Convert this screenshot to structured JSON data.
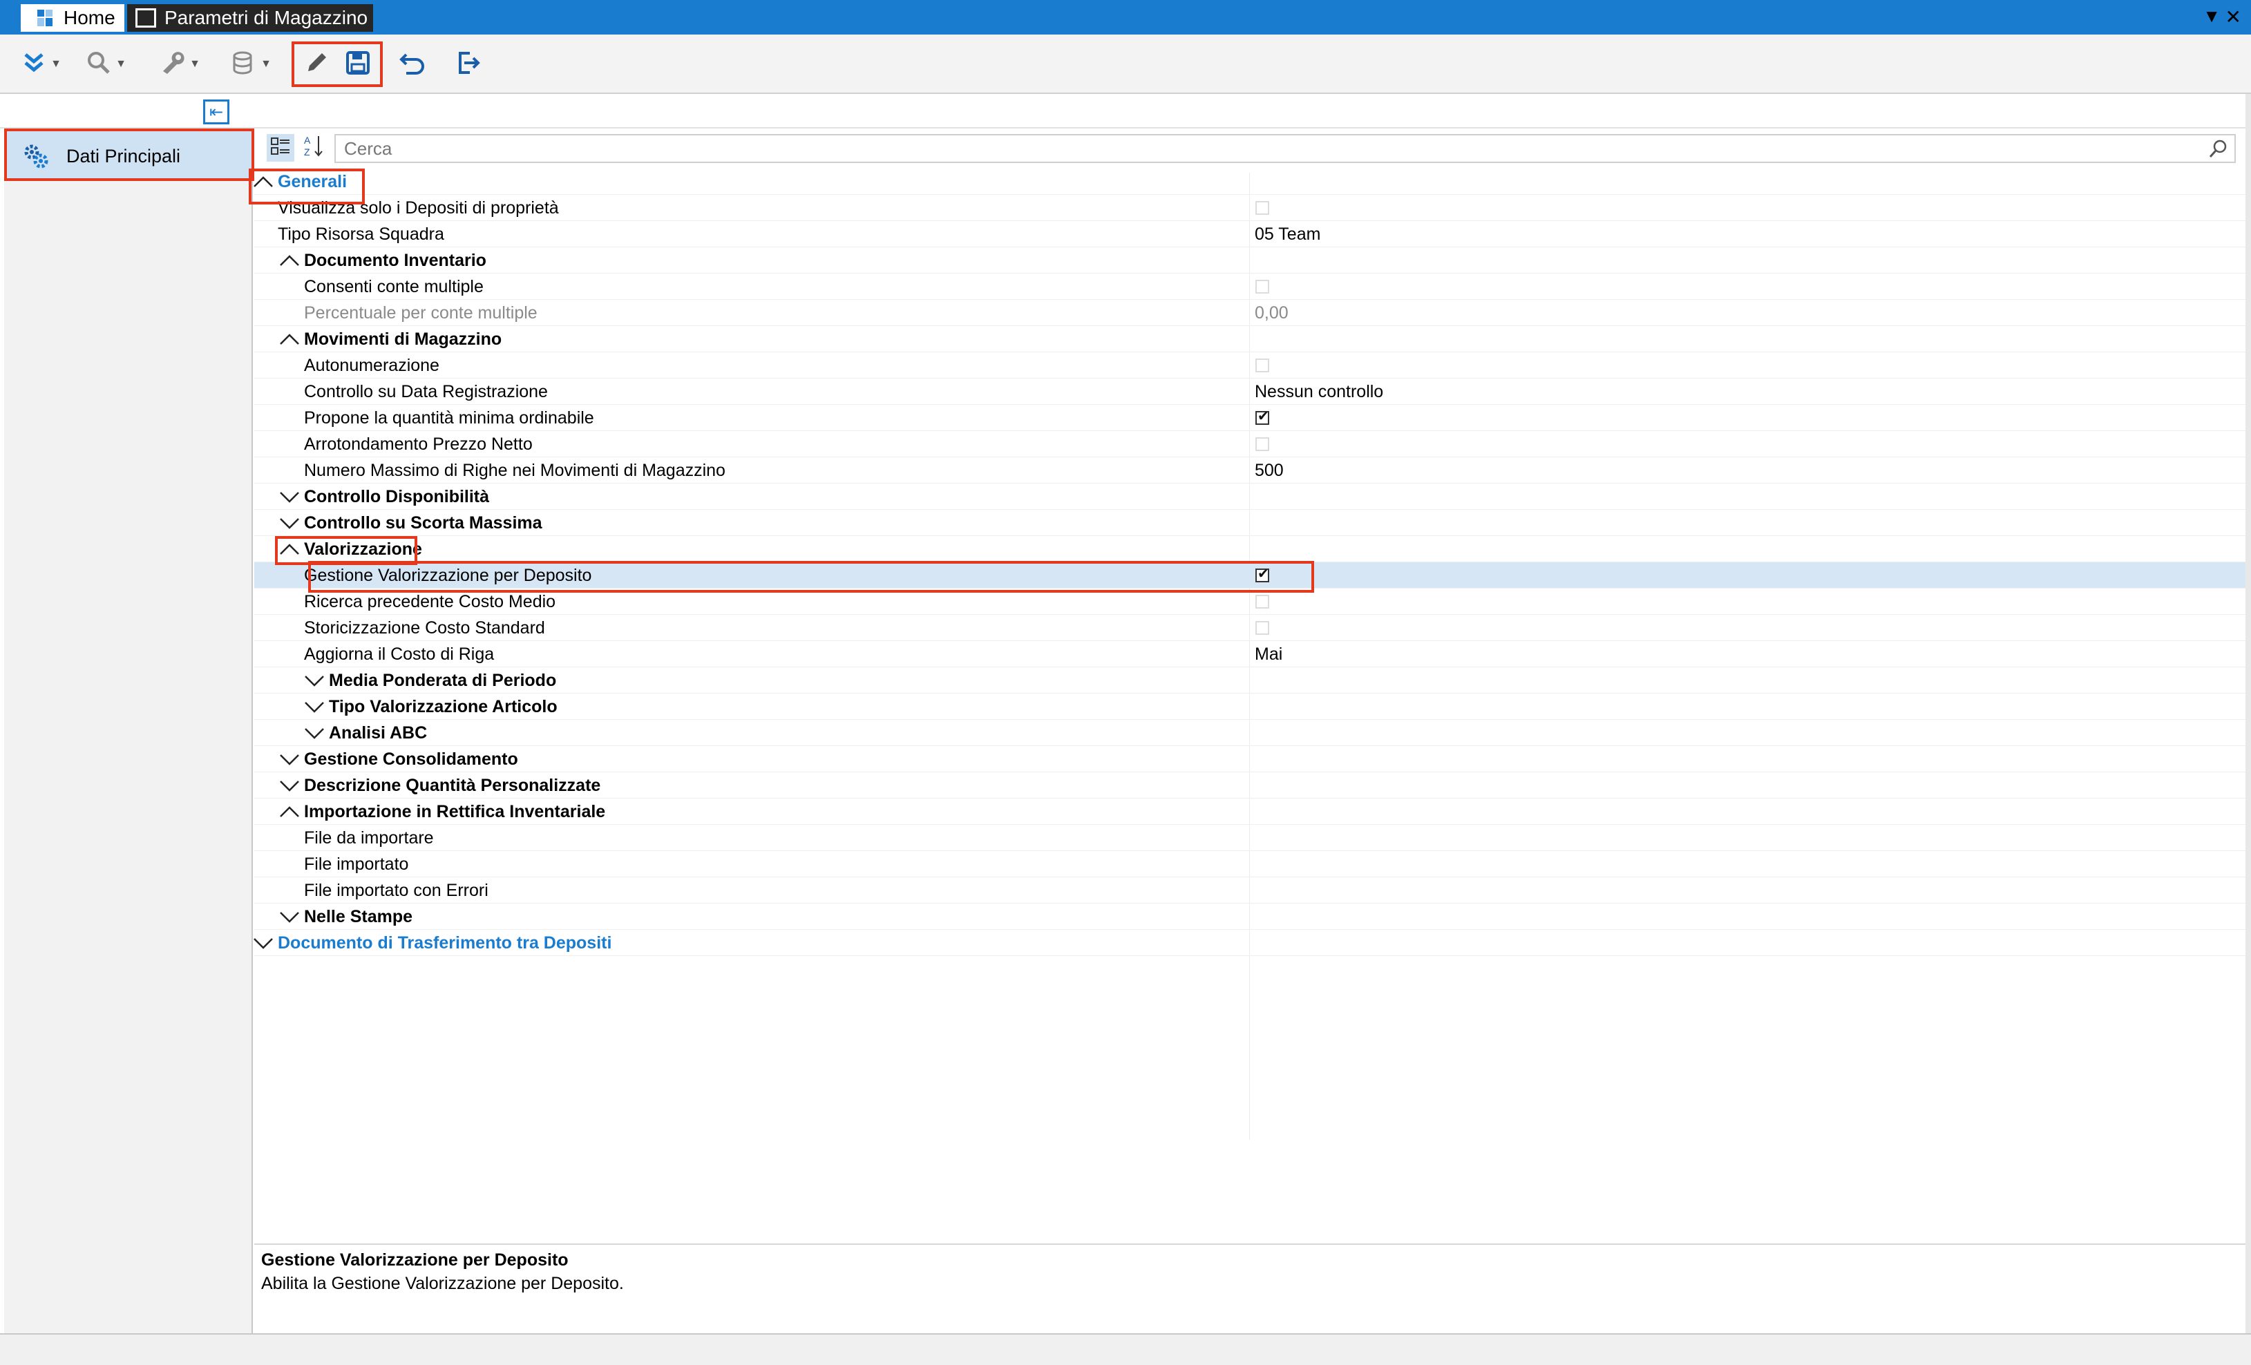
{
  "tabs": [
    {
      "label": "Home"
    },
    {
      "label": "Parametri di Magazzino"
    }
  ],
  "toolbar": {
    "buttons": [
      "expand-icon",
      "search-icon",
      "tools-icon",
      "database-icon",
      "edit-icon",
      "save-icon",
      "undo-icon",
      "exit-icon"
    ]
  },
  "sidebar": {
    "items": [
      {
        "label": "Dati Principali"
      }
    ]
  },
  "search": {
    "placeholder": "Cerca"
  },
  "grid": {
    "rows": [
      {
        "label": "Generali",
        "type": "topcat",
        "expanded": true
      },
      {
        "label": "Visualizza solo i Depositi di proprietà",
        "checked": false
      },
      {
        "label": "Tipo Risorsa Squadra",
        "value": "05 Team"
      },
      {
        "label": "Documento Inventario",
        "type": "cat",
        "expanded": true
      },
      {
        "label": "Consenti conte multiple",
        "checked": false
      },
      {
        "label": "Percentuale per conte multiple",
        "value": "0,00",
        "disabled": true
      },
      {
        "label": "Movimenti di Magazzino",
        "type": "cat",
        "expanded": true
      },
      {
        "label": "Autonumerazione",
        "checked": false
      },
      {
        "label": "Controllo su Data Registrazione",
        "value": "Nessun controllo"
      },
      {
        "label": "Propone la quantità minima ordinabile",
        "checked": true
      },
      {
        "label": "Arrotondamento Prezzo Netto",
        "checked": false
      },
      {
        "label": "Numero Massimo di Righe nei Movimenti di Magazzino",
        "value": "500"
      },
      {
        "label": "Controllo Disponibilità",
        "type": "cat",
        "expanded": false
      },
      {
        "label": "Controllo su Scorta Massima",
        "type": "cat",
        "expanded": false
      },
      {
        "label": "Valorizzazione",
        "type": "cat",
        "expanded": true
      },
      {
        "label": "Gestione Valorizzazione per Deposito",
        "checked": true,
        "selected": true
      },
      {
        "label": "Ricerca precedente Costo Medio",
        "checked": false
      },
      {
        "label": "Storicizzazione Costo Standard",
        "checked": false
      },
      {
        "label": "Aggiorna il Costo di Riga",
        "value": "Mai"
      },
      {
        "label": "Media Ponderata di Periodo",
        "type": "cat",
        "expanded": false
      },
      {
        "label": "Tipo Valorizzazione Articolo",
        "type": "cat",
        "expanded": false
      },
      {
        "label": "Analisi ABC",
        "type": "cat",
        "expanded": false
      },
      {
        "label": "Gestione Consolidamento",
        "type": "cat",
        "expanded": false
      },
      {
        "label": "Descrizione Quantità Personalizzate",
        "type": "cat",
        "expanded": false
      },
      {
        "label": "Importazione in Rettifica Inventariale",
        "type": "cat",
        "expanded": true
      },
      {
        "label": "File da importare",
        "value": ""
      },
      {
        "label": "File importato",
        "value": ""
      },
      {
        "label": "File importato con Errori",
        "value": ""
      },
      {
        "label": "Nelle Stampe",
        "type": "cat",
        "expanded": false
      },
      {
        "label": "Documento di Trasferimento tra Depositi",
        "type": "topcat",
        "expanded": false
      }
    ]
  },
  "description": {
    "title": "Gestione Valorizzazione per Deposito",
    "text": "Abilita la Gestione Valorizzazione per Deposito."
  },
  "colors": {
    "accent": "#1a7ccf",
    "highlight": "#e2391f",
    "selection": "#d6e6f5"
  }
}
